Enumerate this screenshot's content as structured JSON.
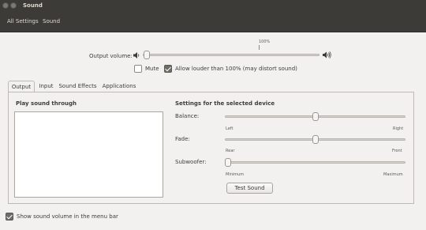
{
  "window": {
    "title": "Sound"
  },
  "menubar": {
    "all_settings": "All Settings",
    "current": "Sound"
  },
  "output_volume": {
    "label": "Output volume:",
    "marker": "100%",
    "level_fraction": 0.0
  },
  "mute": {
    "label": "Mute",
    "checked": false
  },
  "allow_louder": {
    "label": "Allow louder than 100% (may distort sound)",
    "checked": true
  },
  "tabs": [
    {
      "label": "Output",
      "active": true
    },
    {
      "label": "Input",
      "active": false
    },
    {
      "label": "Sound Effects",
      "active": false
    },
    {
      "label": "Applications",
      "active": false
    }
  ],
  "output_panel": {
    "play_through_heading": "Play sound through",
    "settings_heading": "Settings for the selected device",
    "balance": {
      "label": "Balance:",
      "left": "Left",
      "right": "Right",
      "position_fraction": 0.5
    },
    "fade": {
      "label": "Fade:",
      "left": "Rear",
      "right": "Front",
      "position_fraction": 0.5
    },
    "subwoofer": {
      "label": "Subwoofer:",
      "left": "Minimum",
      "right": "Maximum",
      "position_fraction": 0.0
    },
    "test_button": "Test Sound"
  },
  "footer": {
    "show_in_menu_bar": "Show sound volume in the menu bar",
    "checked": true
  },
  "colors": {
    "titlebar": "#3c3b37",
    "window_bg": "#f2f1f0"
  }
}
